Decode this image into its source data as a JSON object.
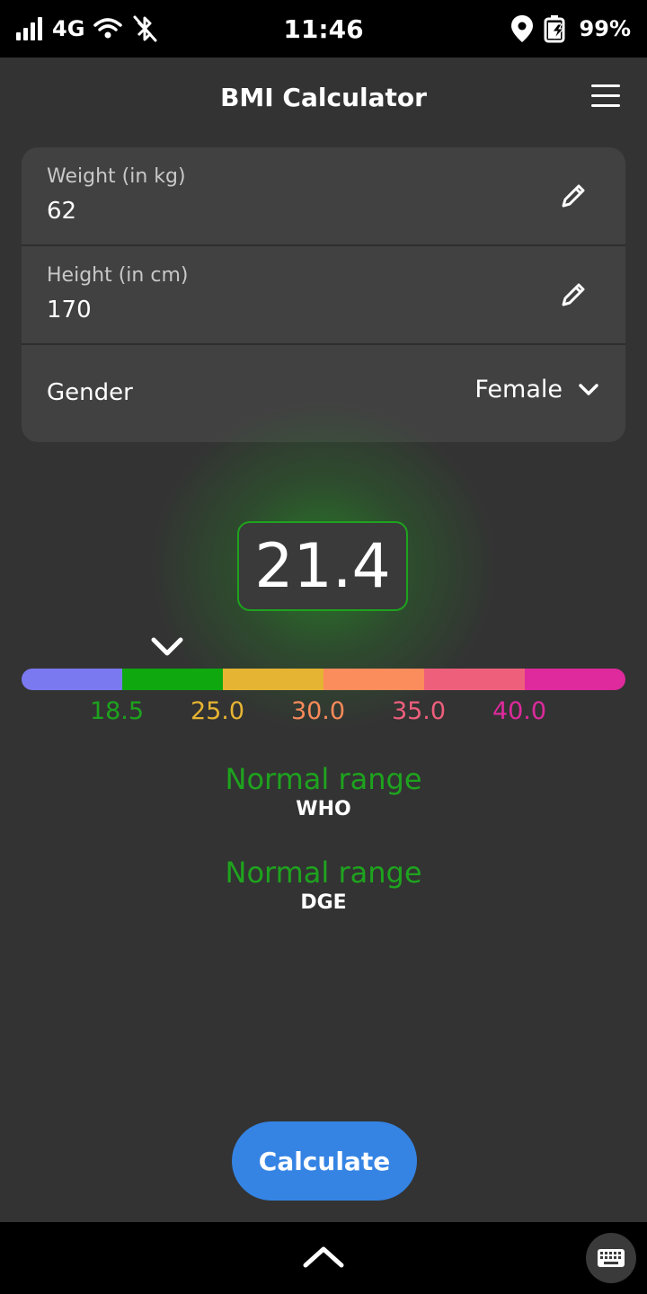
{
  "status_bar": {
    "network": "4G",
    "time": "11:46",
    "battery": "99%",
    "icons": [
      "signal-icon",
      "wifi-icon",
      "bluetooth-off-icon",
      "location-icon",
      "battery-charging-icon"
    ]
  },
  "header": {
    "title": "BMI Calculator",
    "menu_icon": "hamburger-menu-icon"
  },
  "form": {
    "weight": {
      "label": "Weight (in kg)",
      "value": "62"
    },
    "height": {
      "label": "Height (in cm)",
      "value": "170"
    },
    "gender": {
      "label": "Gender",
      "value": "Female"
    }
  },
  "result": {
    "bmi": "21.4",
    "accent_color": "#1ea31e"
  },
  "scale": {
    "segment_colors": [
      "#7b79f0",
      "#0fa80f",
      "#e5b432",
      "#fb8c5c",
      "#ee5f7c",
      "#de2a9c"
    ],
    "ticks": [
      {
        "label": "18.5",
        "color": "#1ea31e"
      },
      {
        "label": "25.0",
        "color": "#e5b432"
      },
      {
        "label": "30.0",
        "color": "#f98a5a"
      },
      {
        "label": "35.0",
        "color": "#ee5f7c"
      },
      {
        "label": "40.0",
        "color": "#de2a9c"
      }
    ]
  },
  "classifications": [
    {
      "name": "Normal range",
      "source": "WHO"
    },
    {
      "name": "Normal range",
      "source": "DGE"
    }
  ],
  "actions": {
    "calculate_label": "Calculate",
    "button_color": "#3584e4"
  },
  "nav": {
    "up_icon": "chevron-up-icon",
    "keyboard_icon": "keyboard-icon"
  }
}
